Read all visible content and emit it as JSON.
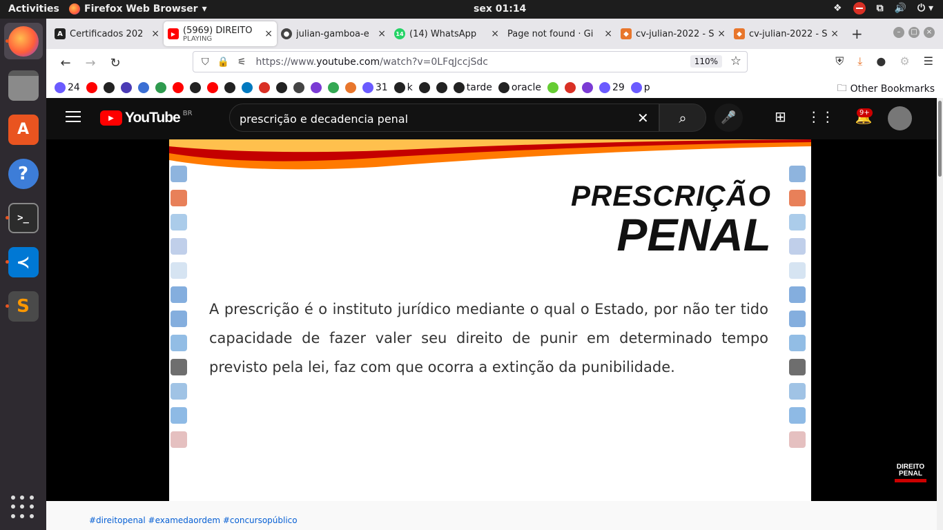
{
  "system": {
    "activities": "Activities",
    "app_name": "Firefox Web Browser",
    "clock": "sex 01:14"
  },
  "tabs": [
    {
      "title": "Certificados 202",
      "icon_color": "#222",
      "icon": "A"
    },
    {
      "title": "(5969) DIREITO",
      "subtitle": "PLAYING",
      "icon_color": "#f00",
      "icon": "▶",
      "active": true
    },
    {
      "title": "julian-gamboa-e",
      "icon_color": "#444",
      "icon": "●"
    },
    {
      "title": "(14) WhatsApp",
      "icon_color": "#25d366",
      "icon": "14"
    },
    {
      "title": "Page not found · Gi",
      "icon_color": "#e7e6ea",
      "icon": ""
    },
    {
      "title": "cv-julian-2022 - S",
      "icon_color": "#e8762c",
      "icon": "◆"
    },
    {
      "title": "cv-julian-2022 - S",
      "icon_color": "#e8762c",
      "icon": "◆"
    }
  ],
  "nav": {
    "url_prefix": "https://www.",
    "url_domain": "youtube.com",
    "url_path": "/watch?v=0LFqJccjSdc",
    "zoom": "110%"
  },
  "bookmarks": [
    {
      "label": "24",
      "color": "#6b5bff"
    },
    {
      "label": "",
      "color": "#f00"
    },
    {
      "label": "",
      "color": "#222"
    },
    {
      "label": "",
      "color": "#4b3bb5"
    },
    {
      "label": "",
      "color": "#3b6fd4"
    },
    {
      "label": "",
      "color": "#2e9a4e"
    },
    {
      "label": "",
      "color": "#f00"
    },
    {
      "label": "",
      "color": "#222"
    },
    {
      "label": "",
      "color": "#f00"
    },
    {
      "label": "",
      "color": "#222"
    },
    {
      "label": "",
      "color": "#0079bf"
    },
    {
      "label": "",
      "color": "#d93025"
    },
    {
      "label": "",
      "color": "#222"
    },
    {
      "label": "",
      "color": "#444"
    },
    {
      "label": "",
      "color": "#7b3bd4"
    },
    {
      "label": "",
      "color": "#34a853"
    },
    {
      "label": "",
      "color": "#e8762c"
    },
    {
      "label": "31",
      "color": "#6b5bff"
    },
    {
      "label": "k",
      "color": "#222"
    },
    {
      "label": "",
      "color": "#222"
    },
    {
      "label": "",
      "color": "#222"
    },
    {
      "label": "tarde",
      "color": "#222"
    },
    {
      "label": "oracle",
      "color": "#222"
    },
    {
      "label": "",
      "color": "#66cc33"
    },
    {
      "label": "",
      "color": "#d93025"
    },
    {
      "label": "",
      "color": "#7b3bd4"
    },
    {
      "label": "29",
      "color": "#6b5bff"
    },
    {
      "label": "p",
      "color": "#6b5bff"
    }
  ],
  "other_bookmarks": "Other Bookmarks",
  "youtube": {
    "logo": "YouTube",
    "region": "BR",
    "search_value": "prescrição e decadencia penal",
    "notifications": "9+"
  },
  "slide": {
    "title_line1": "PRESCRIÇÃO",
    "title_line2": "PENAL",
    "body": "A prescrição é o instituto jurídico mediante o qual o Estado, por não ter tido capacidade de fazer valer seu direito de punir em determinado tempo previsto pela lei, faz com que ocorra a extinção da punibilidade."
  },
  "watermark": {
    "line1": "DIREITO",
    "line2": "PENAL"
  },
  "hashtags": "#direitopenal #examedaordem #concursopúblico"
}
